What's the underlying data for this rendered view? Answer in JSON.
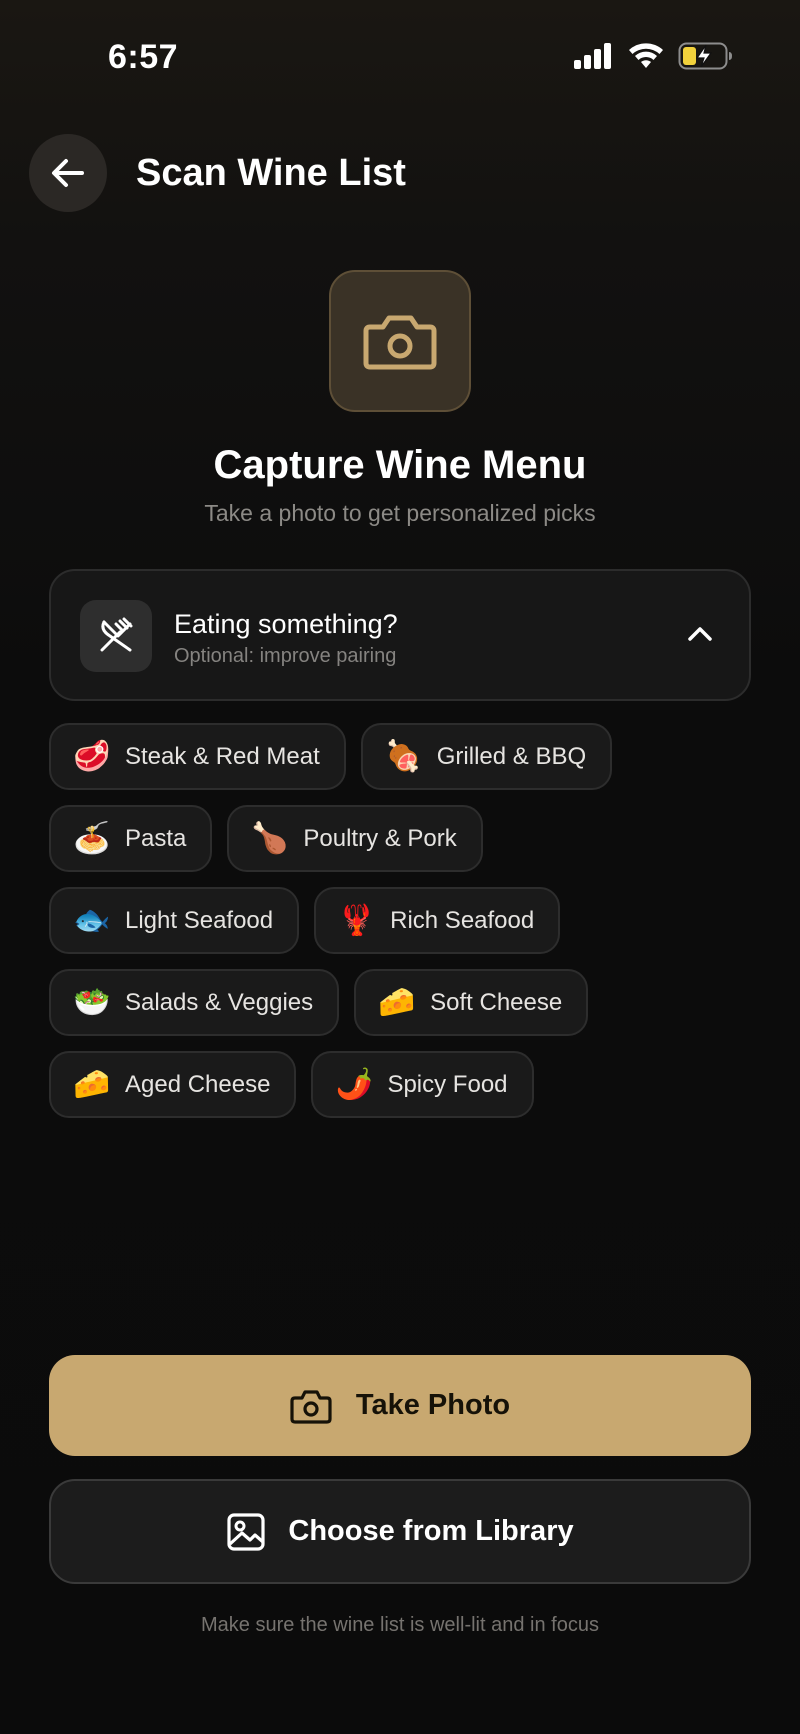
{
  "status_bar": {
    "time": "6:57",
    "icons": [
      "signal-icon",
      "wifi-icon",
      "battery-charging-icon"
    ]
  },
  "header": {
    "back_icon": "arrow-left-icon",
    "title": "Scan Wine List"
  },
  "hero": {
    "icon": "camera-icon",
    "title": "Capture Wine Menu",
    "subtitle": "Take a photo to get personalized picks"
  },
  "pairing": {
    "icon": "utensils-crossed-icon",
    "title": "Eating something?",
    "subtitle": "Optional: improve pairing",
    "toggle_icon": "chevron-up-icon",
    "expanded": true,
    "chip_rows": [
      [
        {
          "emoji": "🥩",
          "label": "Steak & Red Meat"
        },
        {
          "emoji": "🍖",
          "label": "Grilled & BBQ"
        }
      ],
      [
        {
          "emoji": "🍝",
          "label": "Pasta"
        },
        {
          "emoji": "🍗",
          "label": "Poultry & Pork"
        }
      ],
      [
        {
          "emoji": "🐟",
          "label": "Light Seafood"
        },
        {
          "emoji": "🦞",
          "label": "Rich Seafood"
        }
      ],
      [
        {
          "emoji": "🥗",
          "label": "Salads & Veggies"
        },
        {
          "emoji": "🧀",
          "label": "Soft Cheese"
        }
      ],
      [
        {
          "emoji": "🧀",
          "label": "Aged Cheese"
        },
        {
          "emoji": "🌶️",
          "label": "Spicy Food"
        }
      ]
    ]
  },
  "actions": {
    "take_photo": {
      "icon": "camera-icon",
      "label": "Take Photo"
    },
    "library": {
      "icon": "image-icon",
      "label": "Choose from Library"
    }
  },
  "footer_hint": "Make sure the wine list is well-lit and in focus",
  "colors": {
    "accent": "#c8a870",
    "background": "#0b0b0b",
    "card": "#171717",
    "chip_border": "#2d2d2d"
  }
}
